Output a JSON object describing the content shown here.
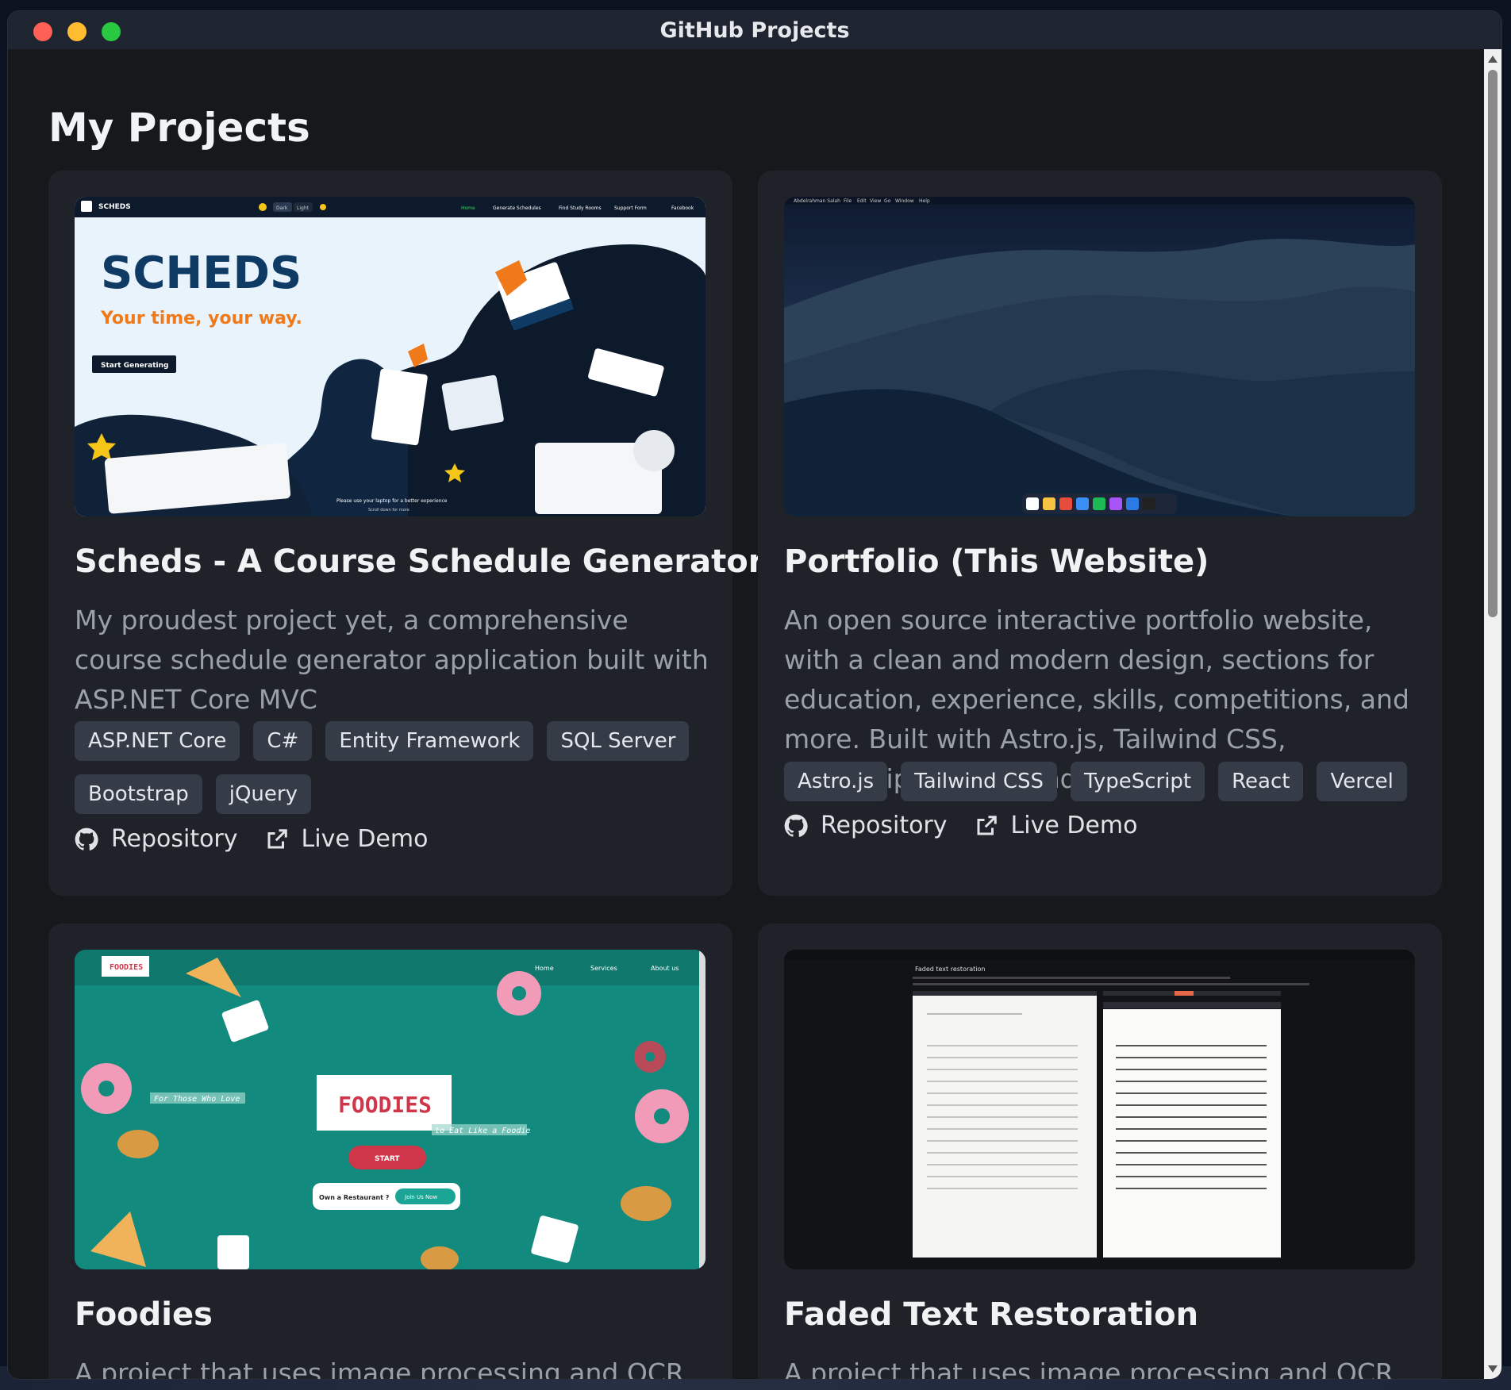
{
  "window": {
    "title": "GitHub Projects"
  },
  "page": {
    "title": "My Projects"
  },
  "projects": [
    {
      "title": "Scheds - A Course Schedule Generator",
      "description": "My proudest project yet, a comprehensive course schedule generator application built with ASP.NET Core MVC",
      "tags": [
        "ASP.NET Core",
        "C#",
        "Entity Framework",
        "SQL Server",
        "Bootstrap",
        "jQuery"
      ],
      "repo_label": "Repository",
      "demo_label": "Live Demo",
      "thumb": {
        "brand": "SCHEDS",
        "nav": [
          "Dark",
          "Light",
          "Home",
          "Generate Schedules",
          "Find Study Rooms",
          "Support Form",
          "Facebook"
        ],
        "headline": "SCHEDS",
        "tagline": "Your time, your way.",
        "cta": "Start Generating",
        "footer": "Please use your laptop for a better experience",
        "scroll_hint": "Scroll down for more"
      }
    },
    {
      "title": "Portfolio (This Website)",
      "description": "An open source interactive portfolio website, with a clean and modern design, sections for education, experience, skills, competitions, and more. Built with Astro.js, Tailwind CSS, TypeScript, React, and Vercel.",
      "tags": [
        "Astro.js",
        "Tailwind CSS",
        "TypeScript",
        "React",
        "Vercel"
      ],
      "repo_label": "Repository",
      "demo_label": "Live Demo",
      "thumb": {
        "menubar_name": "Abdelrahman Salah",
        "menubar_items": [
          "File",
          "Edit",
          "View",
          "Go",
          "Window",
          "Help"
        ]
      }
    },
    {
      "title": "Foodies",
      "description": "A project that uses image processing and OCR to",
      "thumb": {
        "logo": "FOODIES",
        "nav": [
          "Home",
          "Services",
          "About us"
        ],
        "left_caption": "For Those Who Love",
        "headline": "FOODIES",
        "right_caption": "to Eat Like a Foodie",
        "start": "START",
        "owner_prompt": "Own a Restaurant ?",
        "join": "Join Us Now"
      }
    },
    {
      "title": "Faded Text Restoration",
      "description": "A project that uses image processing and OCR to",
      "thumb": {
        "heading": "Faded text restoration"
      }
    }
  ],
  "colors": {
    "background": "#16181c",
    "card": "#1f2329",
    "tag": "#353c47",
    "titlebar": "#1e2530"
  }
}
